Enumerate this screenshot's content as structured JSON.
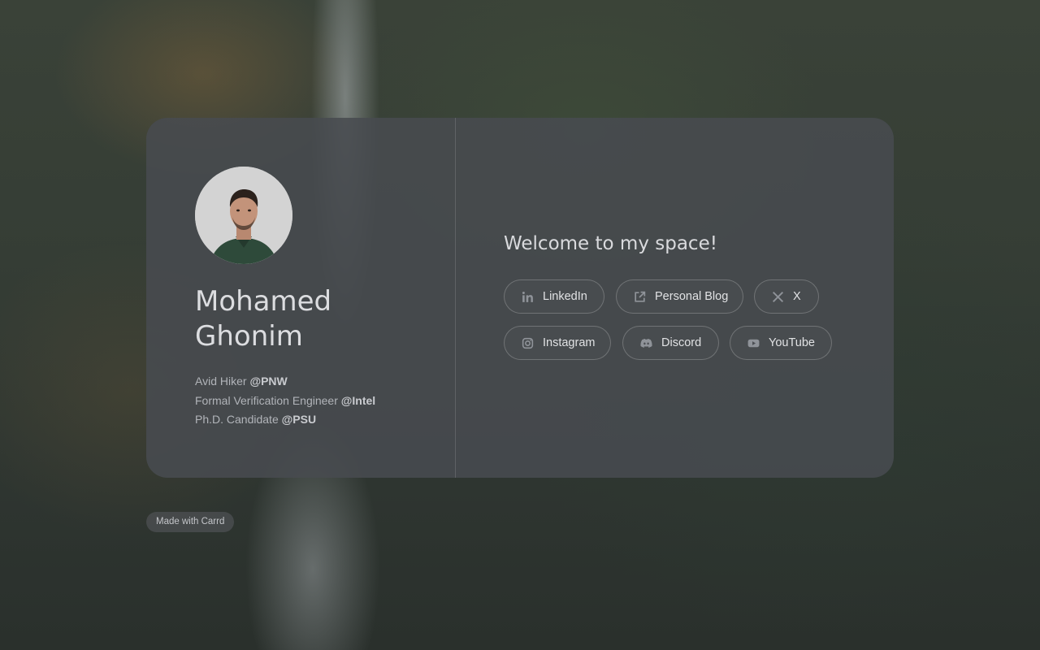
{
  "profile": {
    "name_line1": "Mohamed",
    "name_line2": "Ghonim",
    "bio": [
      {
        "text": "Avid Hiker ",
        "org": "@PNW"
      },
      {
        "text": "Formal Verification Engineer ",
        "org": "@Intel"
      },
      {
        "text": "Ph.D. Candidate ",
        "org": "@PSU"
      }
    ]
  },
  "welcome": "Welcome to my space!",
  "links": {
    "linkedin": {
      "label": "LinkedIn",
      "icon": "linkedin-icon"
    },
    "blog": {
      "label": "Personal Blog",
      "icon": "external-link-icon"
    },
    "x": {
      "label": "X",
      "icon": "x-icon"
    },
    "instagram": {
      "label": "Instagram",
      "icon": "instagram-icon"
    },
    "discord": {
      "label": "Discord",
      "icon": "discord-icon"
    },
    "youtube": {
      "label": "YouTube",
      "icon": "youtube-icon"
    }
  },
  "footer": {
    "made_with": "Made with Carrd"
  },
  "colors": {
    "card": "#484b50",
    "text": "#dcdde0",
    "muted": "#b1b4b9"
  }
}
